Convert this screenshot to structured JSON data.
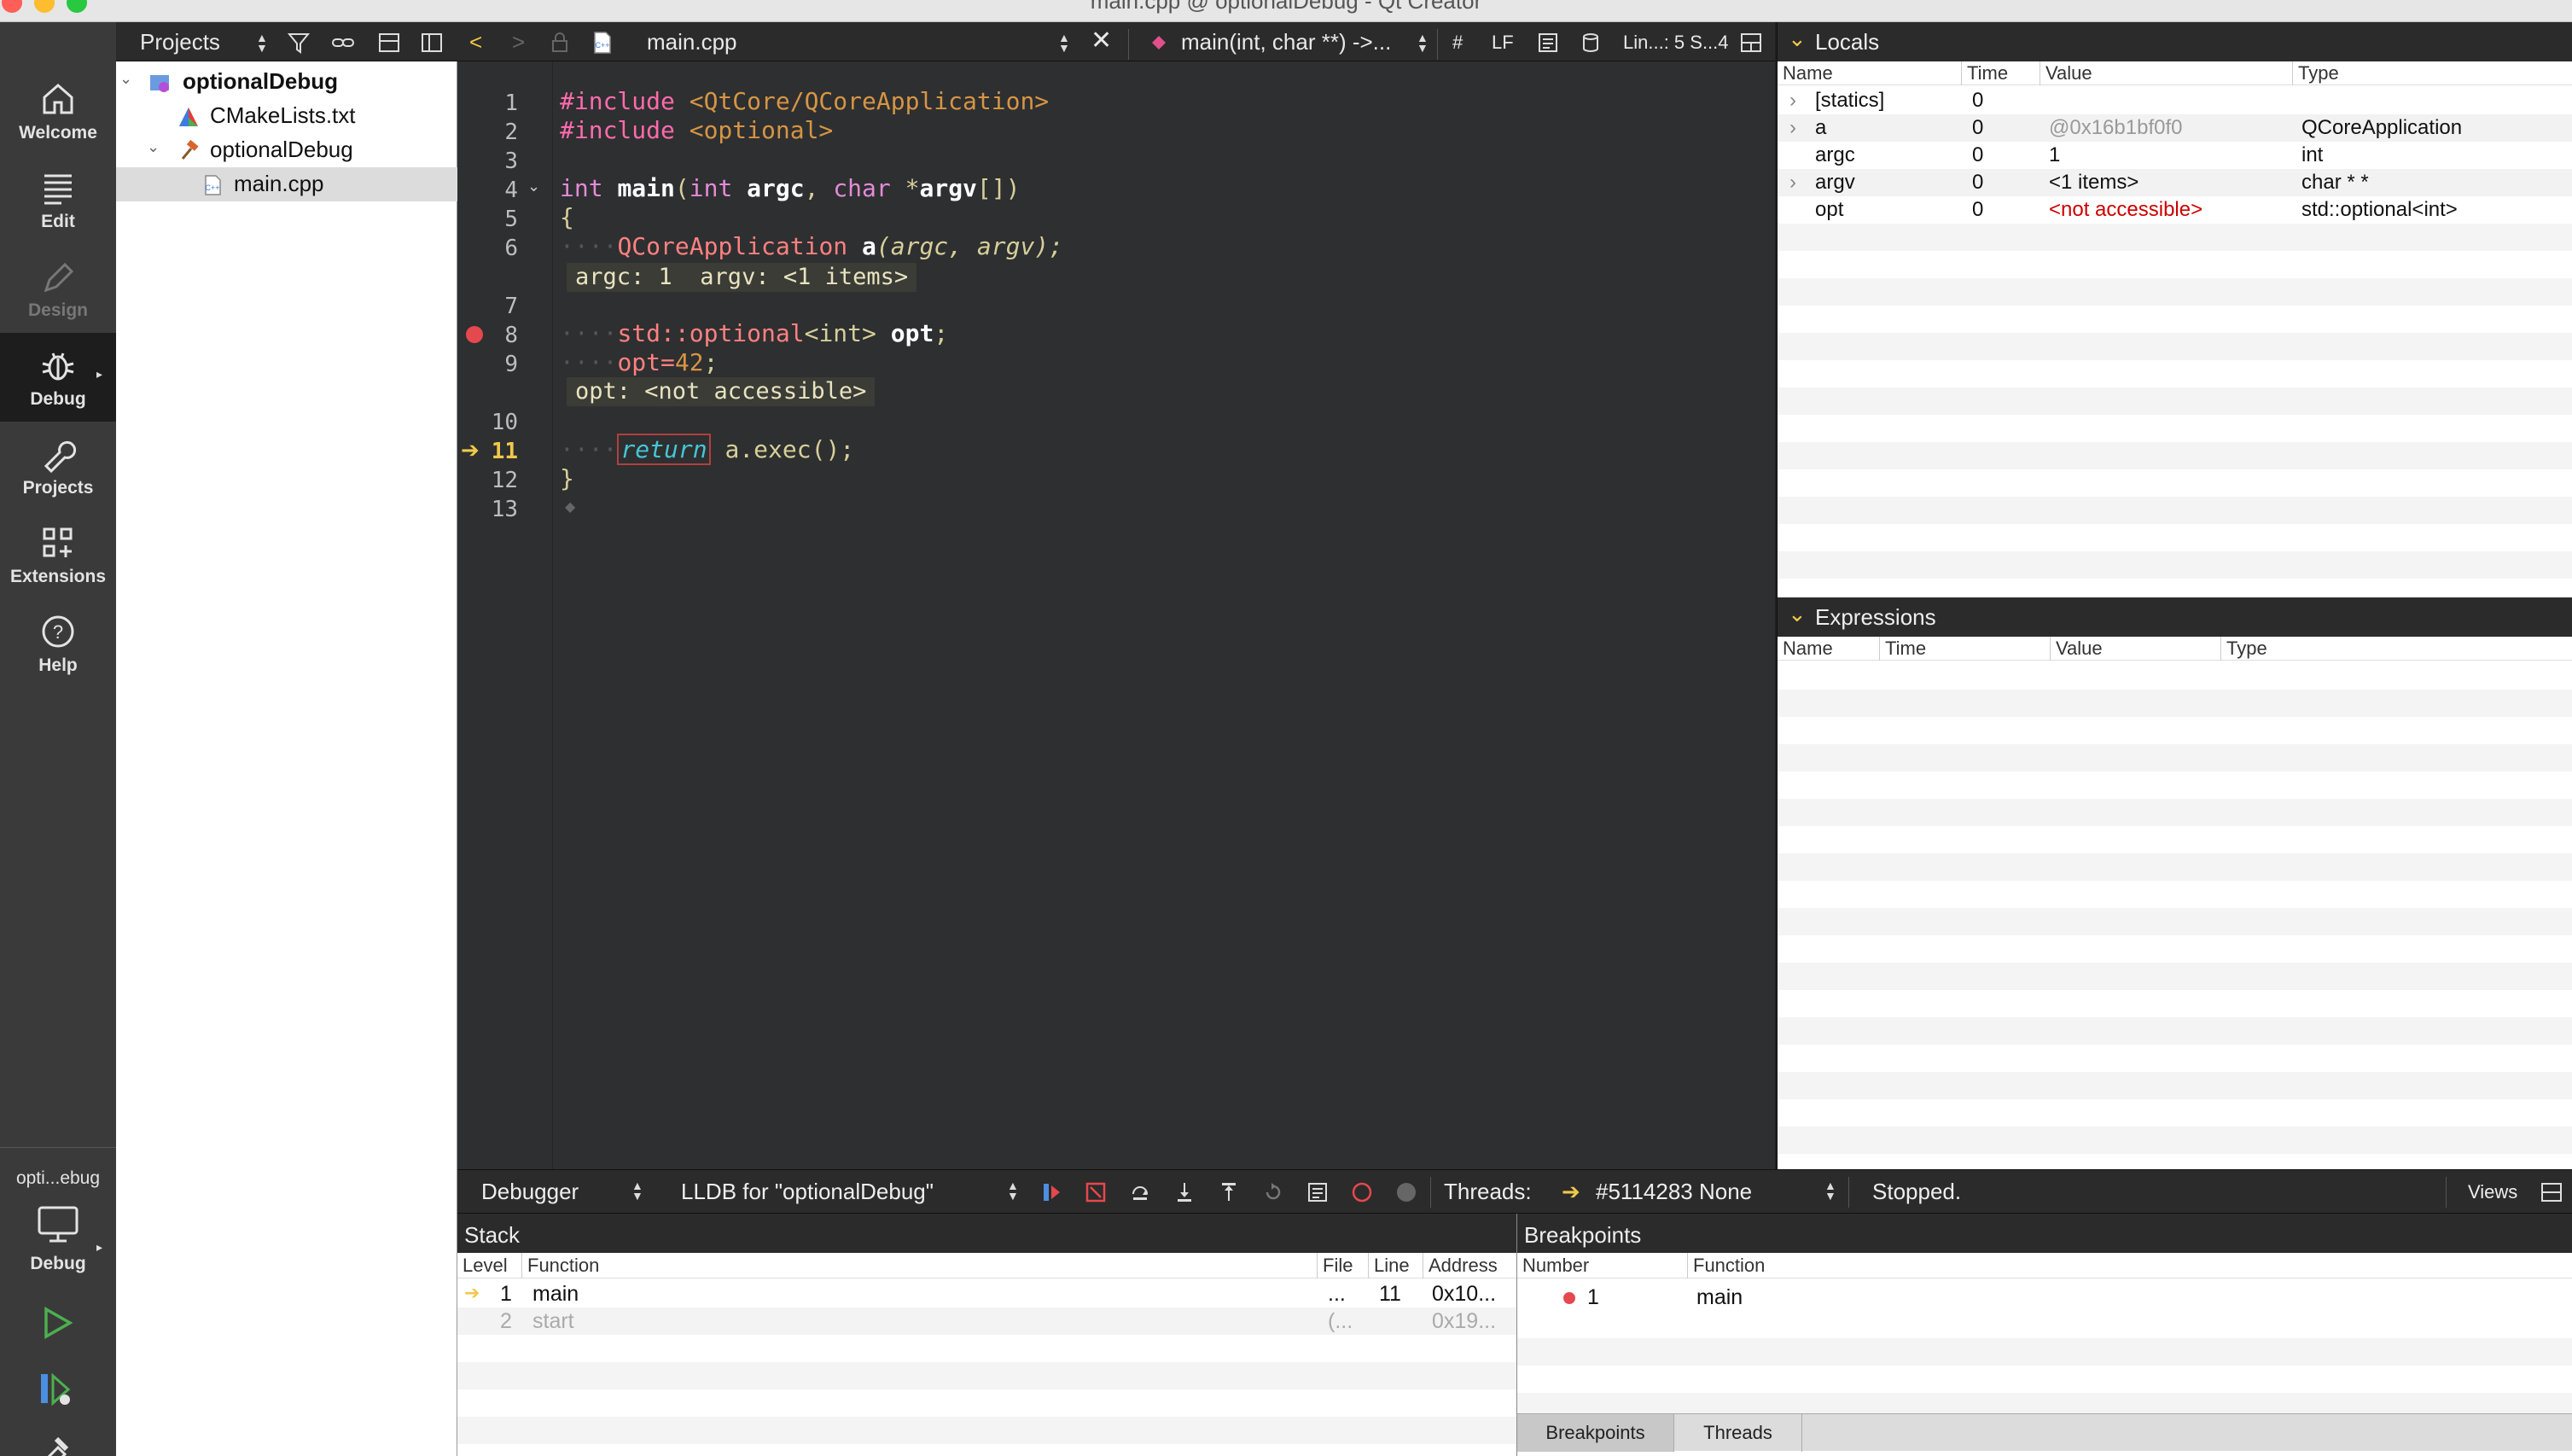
{
  "window": {
    "title": "main.cpp @ optionalDebug - Qt Creator"
  },
  "modes": [
    {
      "label": "Welcome",
      "icon": "home-icon"
    },
    {
      "label": "Edit",
      "icon": "edit-lines-icon"
    },
    {
      "label": "Design",
      "icon": "pen-icon",
      "disabled": true
    },
    {
      "label": "Debug",
      "icon": "bug-icon",
      "active": true
    },
    {
      "label": "Projects",
      "icon": "wrench-icon"
    },
    {
      "label": "Extensions",
      "icon": "grid-plus-icon"
    },
    {
      "label": "Help",
      "icon": "help-circle-icon"
    }
  ],
  "kit": {
    "project_label": "opti...ebug",
    "build_label": "Debug"
  },
  "project_pane": {
    "selector": "Projects",
    "tree": [
      {
        "label": "optionalDebug",
        "bold": true,
        "icon": "cmake-project-icon"
      },
      {
        "label": "CMakeLists.txt",
        "icon": "cmake-file-icon"
      },
      {
        "label": "optionalDebug",
        "icon": "hammer-icon"
      },
      {
        "label": "main.cpp",
        "icon": "cpp-file-icon",
        "selected": true
      }
    ]
  },
  "editor": {
    "file": "main.cpp",
    "symbol": "main(int, char **) ->...",
    "hash": "#",
    "line_ending": "LF",
    "position": "Lin...: 5  S...4",
    "line_numbers": [
      "1",
      "2",
      "3",
      "4",
      "5",
      "6",
      "7",
      "8",
      "9",
      "10",
      "11",
      "12",
      "13"
    ],
    "current_line": "11",
    "breakpoint_line": "8",
    "tooltips": {
      "after_line_6": "argc: 1  argv: <1 items>",
      "after_line_9": "opt: <not accessible>"
    },
    "code": {
      "l1_pp": "#include",
      "l1_inc": "<QtCore/QCoreApplication>",
      "l2_pp": "#include",
      "l2_inc": "<optional>",
      "l4_int": "int",
      "l4_main": "main",
      "l4_p1": "(",
      "l4_int2": "int",
      "l4_argc": "argc",
      "l4_comma": ",",
      "l4_char": "char",
      "l4_star": "*",
      "l4_argv": "argv",
      "l4_end": "[])",
      "l5": "{",
      "l6_ws": "····",
      "l6_cls": "QCoreApplication",
      "l6_a": "a",
      "l6_rest": "(argc, argv);",
      "l8_ws": "····",
      "l8_std": "std::optional",
      "l8_tmpl": "<int>",
      "l8_opt": "opt",
      "l8_semi": ";",
      "l9_ws": "····",
      "l9_opt": "opt=",
      "l9_num": "42",
      "l9_semi": ";",
      "l11_ws": "····",
      "l11_ret": "return",
      "l11_rest": " a.exec();",
      "l12": "}"
    }
  },
  "locals": {
    "title": "Locals",
    "columns": [
      "Name",
      "Time",
      "Value",
      "Type"
    ],
    "rows": [
      {
        "name": "[statics]",
        "time": "0",
        "value": "",
        "type": "",
        "expandable": true
      },
      {
        "name": "a",
        "time": "0",
        "value": "@0x16b1bf0f0",
        "type": "QCoreApplication",
        "expandable": true,
        "value_style": "gray"
      },
      {
        "name": "argc",
        "time": "0",
        "value": "1",
        "type": "int"
      },
      {
        "name": "argv",
        "time": "0",
        "value": "<1 items>",
        "type": "char * *",
        "expandable": true
      },
      {
        "name": "opt",
        "time": "0",
        "value": "<not accessible>",
        "type": "std::optional<int>",
        "value_style": "red"
      }
    ]
  },
  "expressions": {
    "title": "Expressions",
    "columns": [
      "Name",
      "Time",
      "Value",
      "Type"
    ]
  },
  "debugger_bar": {
    "mode": "Debugger",
    "engine": "LLDB for \"optionalDebug\"",
    "threads_label": "Threads:",
    "thread": "#5114283 None",
    "status": "Stopped.",
    "views": "Views"
  },
  "stack": {
    "title": "Stack",
    "columns": [
      "Level",
      "Function",
      "File",
      "Line",
      "Address"
    ],
    "rows": [
      {
        "level": "1",
        "function": "main",
        "file": "...",
        "line": "11",
        "address": "0x10...",
        "current": true
      },
      {
        "level": "2",
        "function": "start",
        "file": "(...",
        "line": "",
        "address": "0x19...",
        "dim": true
      }
    ]
  },
  "breakpoints": {
    "title": "Breakpoints",
    "columns": [
      "Number",
      "Function"
    ],
    "rows": [
      {
        "number": "1",
        "function": "main"
      }
    ],
    "tabs": [
      "Breakpoints",
      "Threads"
    ]
  },
  "colors": {
    "traffic_red": "#ff5f57",
    "traffic_yellow": "#febc2e",
    "traffic_green": "#28c840",
    "breakpoint": "#e5484d",
    "current_arrow": "#f0c94a"
  }
}
